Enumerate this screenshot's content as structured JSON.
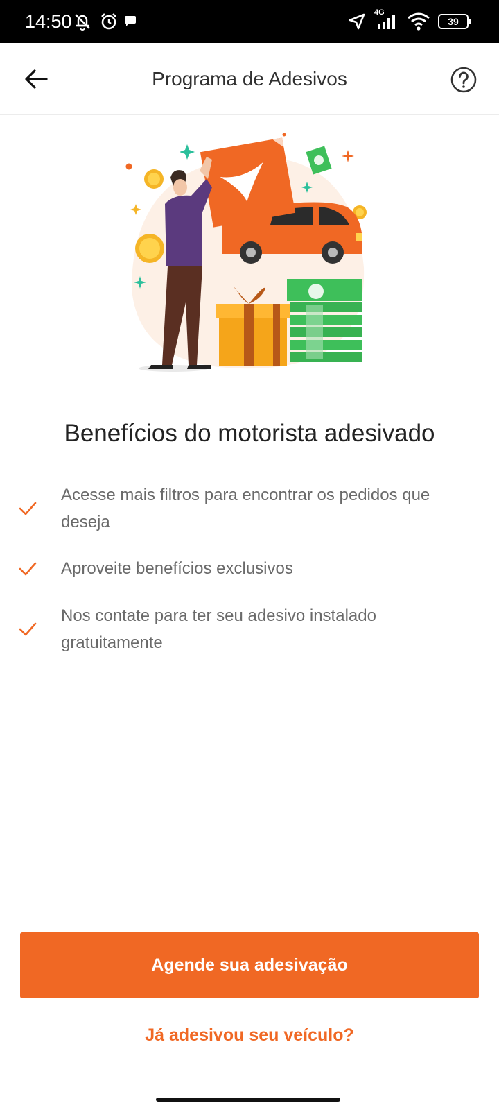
{
  "status_bar": {
    "time": "14:50",
    "network": "4G",
    "battery": "39"
  },
  "header": {
    "title": "Programa de Adesivos",
    "back_icon": "arrow-left-icon",
    "help_icon": "question-circle-icon"
  },
  "main": {
    "headline": "Benefícios do motorista adesivado",
    "benefits": [
      {
        "text": "Acesse mais filtros para encontrar os pedidos que deseja"
      },
      {
        "text": "Aproveite benefícios exclusivos"
      },
      {
        "text": "Nos contate para ter seu adesivo instalado gratuitamente"
      }
    ]
  },
  "actions": {
    "primary_label": "Agende sua adesivação",
    "secondary_label": "Já adesivou seu veículo?"
  },
  "colors": {
    "accent": "#f06824",
    "check": "#f06824"
  }
}
